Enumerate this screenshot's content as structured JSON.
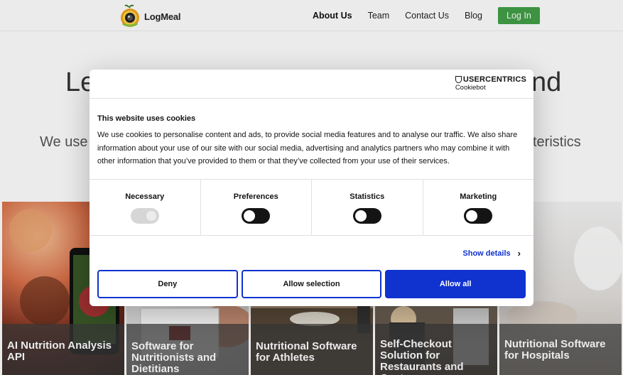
{
  "header": {
    "logo_text": "LogMeal",
    "nav": [
      {
        "label": "About Us",
        "active": true
      },
      {
        "label": "Team",
        "active": false
      },
      {
        "label": "Contact Us",
        "active": false
      },
      {
        "label": "Blog",
        "active": false
      }
    ],
    "login_label": "Log In",
    "login_color": "#43a047"
  },
  "hero": {
    "title_left_visible": "Le",
    "title_right_visible": "nd",
    "sub_left_visible": "We use",
    "sub_right_visible": "teristics"
  },
  "cards": [
    {
      "label": "AI Nutrition Analysis API"
    },
    {
      "label": "Software for Nutritionists and Dietitians"
    },
    {
      "label": "Nutritional Software for Athletes"
    },
    {
      "label": "Self-Checkout Solution for Restaurants and Canteens"
    },
    {
      "label": "Nutritional Software for Hospitals"
    }
  ],
  "cookie_dialog": {
    "brand_line1": "USERCENTRICS",
    "brand_line2": "Cookiebot",
    "title": "This website uses cookies",
    "text": "We use cookies to personalise content and ads, to provide social media features and to analyse our traffic. We also share information about your use of our site with our social media, advertising and analytics partners who may combine it with other information that you’ve provided to them or that they’ve collected from your use of their services.",
    "categories": [
      {
        "label": "Necessary",
        "enabled": true,
        "locked": true
      },
      {
        "label": "Preferences",
        "enabled": false
      },
      {
        "label": "Statistics",
        "enabled": false
      },
      {
        "label": "Marketing",
        "enabled": false
      }
    ],
    "show_details": "Show details",
    "buttons": {
      "deny": "Deny",
      "allow_selection": "Allow selection",
      "allow_all": "Allow all"
    },
    "accent_color": "#1032cf"
  }
}
